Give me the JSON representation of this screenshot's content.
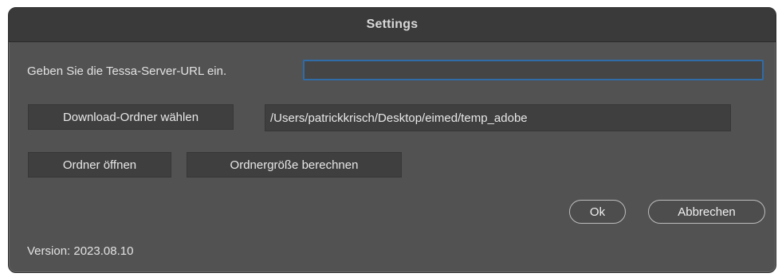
{
  "window": {
    "title": "Settings"
  },
  "server": {
    "label": "Geben Sie die Tessa-Server-URL ein.",
    "url_value": "",
    "accent_color": "#2f6ca8"
  },
  "download": {
    "choose_button": "Download-Ordner wählen",
    "path_value": "/Users/patrickkrisch/Desktop/eimed/temp_adobe"
  },
  "folder_actions": {
    "open_button": "Ordner öffnen",
    "size_button": "Ordnergröße berechnen"
  },
  "dialog_actions": {
    "ok_button": "Ok",
    "cancel_button": "Abbrechen"
  },
  "footer": {
    "version": "Version: 2023.08.10"
  }
}
